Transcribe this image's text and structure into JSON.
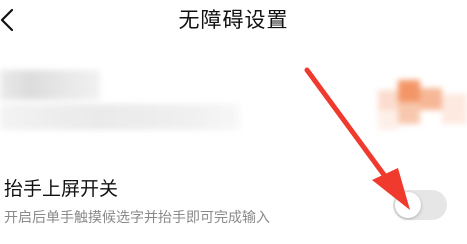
{
  "header": {
    "title": "无障碍设置",
    "back_icon": "chevron-left-icon"
  },
  "setting": {
    "title": "抬手上屏开关",
    "description": "开启后单手触摸候选字并抬手即可完成输入",
    "toggle_on": false
  },
  "colors": {
    "background": "#ffffff",
    "title_text": "#111111",
    "description_text": "#8a8a8a",
    "toggle_off_track": "#e6e6e6",
    "annotation_arrow": "#f03a2e"
  },
  "annotation": {
    "icon": "red-arrow-icon"
  }
}
